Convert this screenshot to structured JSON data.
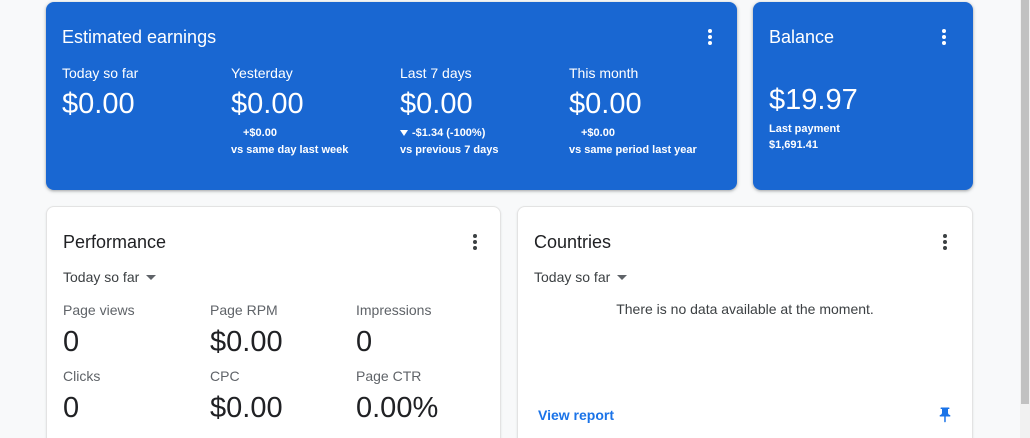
{
  "colors": {
    "card_blue": "#1967d2",
    "link": "#1a73e8"
  },
  "icons": {
    "menu": "more-vert-icon",
    "period_dropdown": "arrow-drop-down-icon",
    "change_down": "arrow-down-icon",
    "pin": "pin-icon"
  },
  "earnings": {
    "title": "Estimated earnings",
    "columns": [
      {
        "label": "Today so far",
        "value": "$0.00"
      },
      {
        "label": "Yesterday",
        "value": "$0.00",
        "change": "+$0.00",
        "comparison": "vs same day last week"
      },
      {
        "label": "Last 7 days",
        "value": "$0.00",
        "change_direction": "down",
        "change": "-$1.34 (-100%)",
        "comparison": "vs previous 7 days"
      },
      {
        "label": "This month",
        "value": "$0.00",
        "change": "+$0.00",
        "comparison": "vs same period last year"
      }
    ]
  },
  "balance": {
    "title": "Balance",
    "value": "$19.97",
    "last_payment_label": "Last payment",
    "last_payment_value": "$1,691.41"
  },
  "performance": {
    "title": "Performance",
    "period": "Today so far",
    "metrics": [
      {
        "label": "Page views",
        "value": "0"
      },
      {
        "label": "Page RPM",
        "value": "$0.00"
      },
      {
        "label": "Impressions",
        "value": "0"
      },
      {
        "label": "Clicks",
        "value": "0"
      },
      {
        "label": "CPC",
        "value": "$0.00"
      },
      {
        "label": "Page CTR",
        "value": "0.00%"
      }
    ]
  },
  "countries": {
    "title": "Countries",
    "period": "Today so far",
    "empty_message": "There is no data available at the moment.",
    "view_report": "View report"
  }
}
